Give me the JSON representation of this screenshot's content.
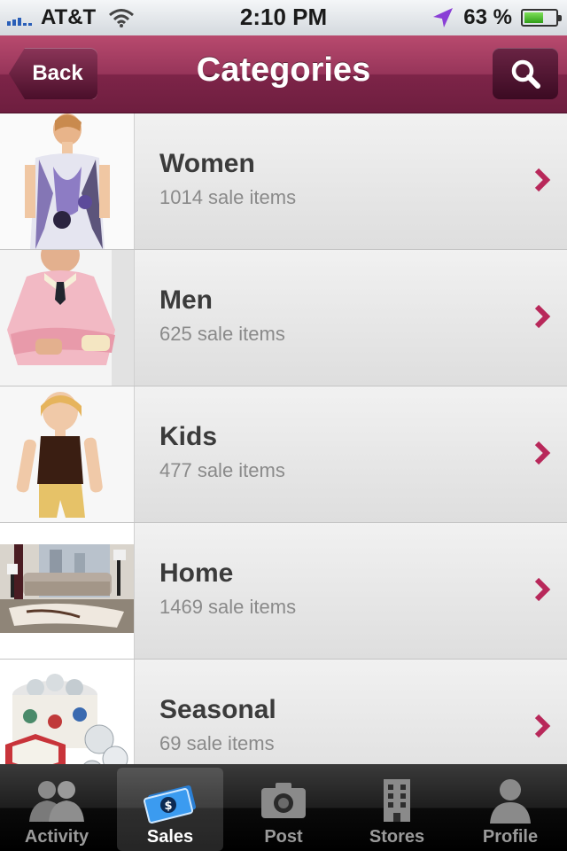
{
  "status_bar": {
    "carrier": "AT&T",
    "time": "2:10 PM",
    "battery_percent": "63 %",
    "battery_level": 0.63
  },
  "nav": {
    "back_label": "Back",
    "title": "Categories",
    "accent": "#8a2c50"
  },
  "categories": [
    {
      "name": "Women",
      "count": "1014 sale items",
      "thumb_icon": "women-dress-photo"
    },
    {
      "name": "Men",
      "count": "625 sale items",
      "thumb_icon": "men-sweater-photo"
    },
    {
      "name": "Kids",
      "count": "477 sale items",
      "thumb_icon": "kids-photo"
    },
    {
      "name": "Home",
      "count": "1469 sale items",
      "thumb_icon": "home-living-room-photo"
    },
    {
      "name": "Seasonal",
      "count": "69 sale items",
      "thumb_icon": "seasonal-ornaments-photo"
    }
  ],
  "tabs": [
    {
      "label": "Activity",
      "icon": "people-icon",
      "active": false
    },
    {
      "label": "Sales",
      "icon": "money-icon",
      "active": true
    },
    {
      "label": "Post",
      "icon": "camera-icon",
      "active": false
    },
    {
      "label": "Stores",
      "icon": "building-icon",
      "active": false
    },
    {
      "label": "Profile",
      "icon": "person-icon",
      "active": false
    }
  ]
}
